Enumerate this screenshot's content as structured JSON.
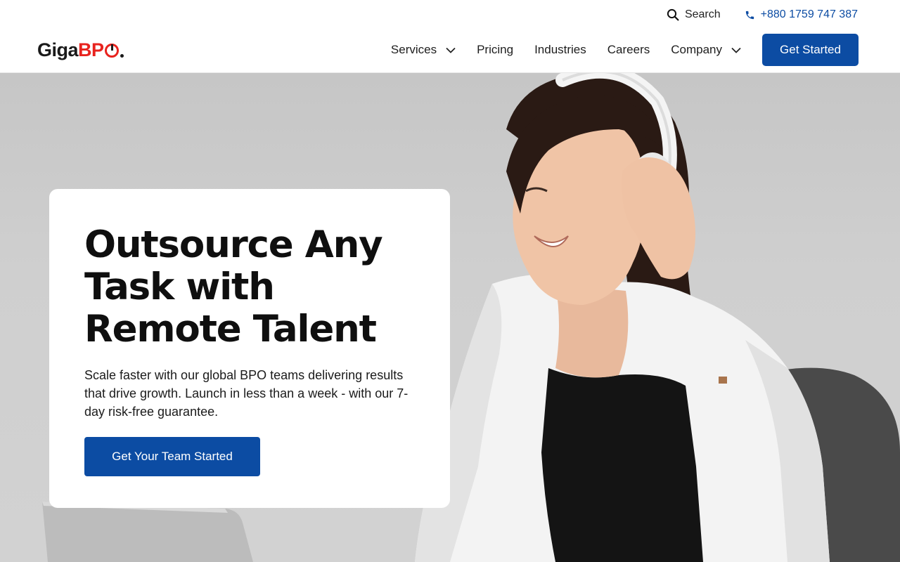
{
  "utility": {
    "search_label": "Search",
    "phone": "+880 1759 747 387"
  },
  "logo": {
    "part1": "Giga",
    "part2": "BP"
  },
  "nav": {
    "items": [
      {
        "label": "Services",
        "has_dropdown": true
      },
      {
        "label": "Pricing",
        "has_dropdown": false
      },
      {
        "label": "Industries",
        "has_dropdown": false
      },
      {
        "label": "Careers",
        "has_dropdown": false
      },
      {
        "label": "Company",
        "has_dropdown": true
      }
    ],
    "cta_label": "Get Started"
  },
  "hero": {
    "title_line1": "Outsource Any",
    "title_line2": "Task with",
    "title_line3": "Remote Talent",
    "description": "Scale faster with our global BPO teams delivering results that drive growth. Launch in less than a week - with our 7-day risk-free guarantee.",
    "button_label": "Get Your Team Started"
  },
  "colors": {
    "brand_blue": "#0c4ca3",
    "logo_red": "#e8231e",
    "hero_bg": "#cbcbcb"
  },
  "icons": {
    "search": "search-icon",
    "phone": "phone-icon",
    "dropdown": "chevron-down-icon"
  }
}
